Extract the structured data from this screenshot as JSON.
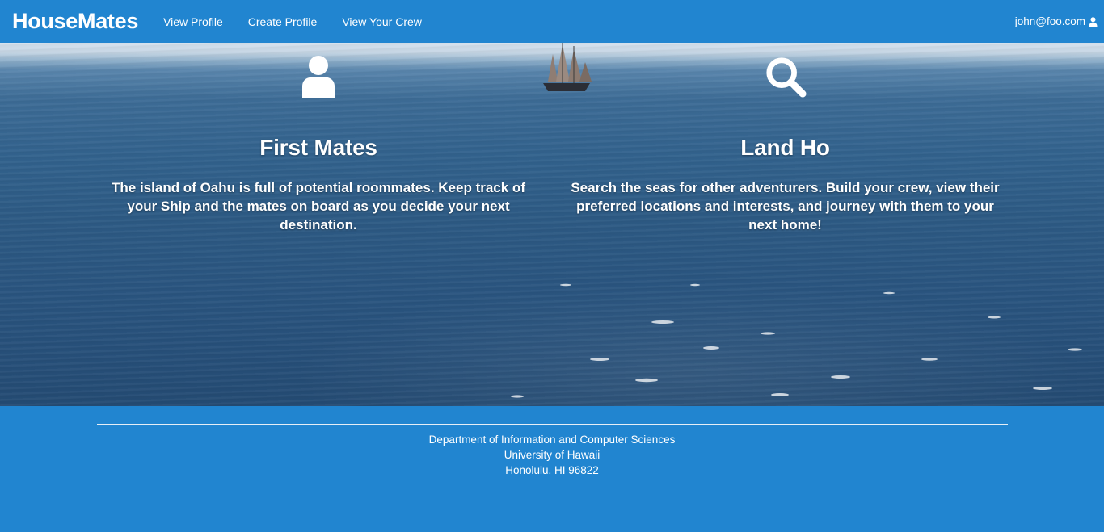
{
  "navbar": {
    "brand": "HouseMates",
    "items": [
      {
        "label": "View Profile"
      },
      {
        "label": "Create Profile"
      },
      {
        "label": "View Your Crew"
      }
    ],
    "user_email": "john@foo.com",
    "user_icon": "user-icon"
  },
  "hero": {
    "features": [
      {
        "icon": "user-icon",
        "title": "First Mates",
        "text": "The island of Oahu is full of potential roommates. Keep track of your Ship and the mates on board as you decide your next destination."
      },
      {
        "icon": "search-icon",
        "title": "Land Ho",
        "text": "Search the seas for other adventurers. Build your crew, view their preferred locations and interests, and journey with them to your next home!"
      }
    ]
  },
  "footer": {
    "line1": "Department of Information and Computer Sciences",
    "line2": "University of Hawaii",
    "line3": "Honolulu, HI 96822"
  },
  "colors": {
    "primary": "#2185d0",
    "text": "#ffffff"
  }
}
